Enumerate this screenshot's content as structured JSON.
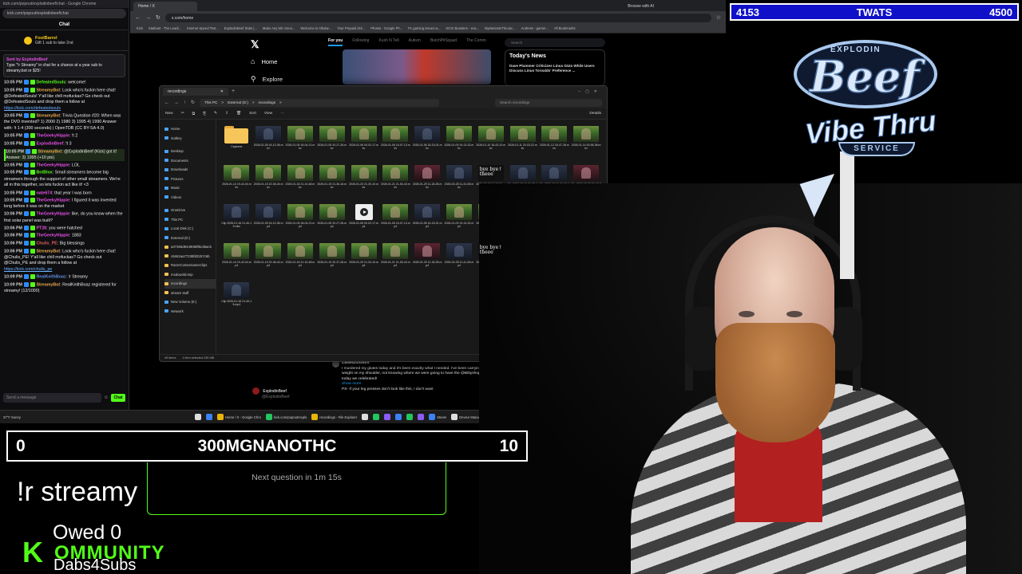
{
  "chat": {
    "window_title": "kick.com/popout/explodinbeef/chat - Google Chrome",
    "url": "kick.com/popout/explodinbeef/chat",
    "header": "Chat",
    "gift_user": "FoolBarrel",
    "gift_text": "Gift 1 sub to take 2nd",
    "pinned_by": "Sent by ExplodinBeef",
    "pinned_text": "Type \"!r Streamy\" in chat for a chance at a year sub to streamy.bot or $25!",
    "messages": [
      {
        "time": "10:05 PM",
        "user": "DefeatedSouls",
        "color": "#53fc18",
        "text": "welcome!"
      },
      {
        "time": "10:05 PM",
        "user": "StreamyBot",
        "color": "#e5a84f",
        "text": "Look who's fuckin here chat! @DefeatedSouls! Y'all like chill mofuckas? Go check out @DefeatedSouls and drop them a follow at",
        "link": "https://kick.com/defeatedsouls"
      },
      {
        "time": "10:05 PM",
        "user": "StreamyBot",
        "color": "#e5a84f",
        "text": "Trivia Question #20: When was the DVD invented? 1) 2000 2) 1980 3) 1995 4) 1990 Answer with: !t 1-4 (300 seconds) | OpenTDB (CC BY-SA 4.0)"
      },
      {
        "time": "10:05 PM",
        "user": "TheGeekyHippie",
        "color": "#e54fe5",
        "text": "!t 2"
      },
      {
        "time": "10:05 PM",
        "user": "ExplodinBeef",
        "color": "#e54fe5",
        "text": "!t 3"
      },
      {
        "time": "10:05 PM",
        "user": "StreamyBot",
        "color": "#e5a84f",
        "text": "@ExplodinBeef (Kick) got it! Answer: 3) 1995 (+10 pts)",
        "highlight": true
      },
      {
        "time": "10:05 PM",
        "user": "TheGeekyHippie",
        "color": "#e54fe5",
        "text": "LOL"
      },
      {
        "time": "10:05 PM",
        "user": "BotBlox",
        "color": "#53fc18",
        "text": "Small streamers become big streamers through the support of other small streamers. We're all in this together, so lets fuckin act like it! <3"
      },
      {
        "time": "10:05 PM",
        "user": "nate674",
        "color": "#e54fe5",
        "text": "that year I was born"
      },
      {
        "time": "10:05 PM",
        "user": "TheGeekyHippie",
        "color": "#e54fe5",
        "text": "I figured it was invented long before it was on the market"
      },
      {
        "time": "10:06 PM",
        "user": "TheGeekyHippie",
        "color": "#e54fe5",
        "text": "like, do you know when the first solar panel was built?"
      },
      {
        "time": "10:06 PM",
        "user": "PT28",
        "color": "#e54fe5",
        "text": "you were hatched"
      },
      {
        "time": "10:06 PM",
        "user": "TheGeekyHippie",
        "color": "#e54fe5",
        "text": "1883"
      },
      {
        "time": "10:06 PM",
        "user": "Chulis_PE",
        "color": "#e55f5f",
        "text": "Big blessings"
      },
      {
        "time": "10:06 PM",
        "user": "StreamyBot",
        "color": "#e5a84f",
        "text": "Look who's fuckin here chat! @Chulis_PE! Y'all like chill mofuckas? Go check out @Chulis_PE and drop them a follow at",
        "link": "https://kick.com/chulis_pe"
      },
      {
        "time": "10:09 PM",
        "user": "RealKeithBoaz",
        "color": "#5f8fe5",
        "text": "!r Streamy"
      },
      {
        "time": "10:09 PM",
        "user": "StreamyBot",
        "color": "#e5a84f",
        "text": "RealKeithBoaz registered for streamy! (12/1000)"
      }
    ],
    "input_placeholder": "Send a message",
    "send_label": "Chat"
  },
  "browser": {
    "tab_title": "Home / X",
    "url": "x.com/home",
    "right_label": "Browse with AI",
    "bookmarks": [
      "Kick",
      "Statbust - The Leadi...",
      "Internet Speed Test...",
      "ExplodinBeef Stats |...",
      "Make Any Mic Soun...",
      "Welcome to Okular...",
      "Your Prepaid (Kit...",
      "Photos - Google Ph...",
      "Pc gaming issues w...",
      "KICK Boosters - eva...",
      "MysteriesInTheJac...",
      "Andress - gamer...",
      "All Bookmarks"
    ],
    "x_nav": [
      {
        "icon": "⌂",
        "label": "Home"
      },
      {
        "icon": "⚲",
        "label": "Explore"
      }
    ],
    "x_tabs": [
      "For you",
      "Following",
      "Kush N Tell",
      "Autism",
      "ButchPitSquad",
      "The Comm"
    ],
    "search_placeholder": "Search",
    "news_title": "Today's News",
    "news_item": "Dave Plummer Criticizes Linux GUIs While Users Discuss Linus Torvalds' Preference ...",
    "post_user": "Lala420tokes",
    "post_text": "I murdered my glutes today and it's been exactly what I needed. I've been carrying around a huge weight on my shoulder, not knowing where we were going to have the @Bittyshop festival, but today we celebrated!",
    "post_text2": "PS- If your leg presses don't look like this, I don't want",
    "post_more": "Show more",
    "account_name": "ExplodinBeef",
    "account_handle": "@ExplodinBeef",
    "footer": "Terms of Service | Privacy Policy | Cookie Policy | Accessibility | Ads info | More | © 2026 X Corp."
  },
  "explorer": {
    "tab_title": "recordings",
    "path": [
      "This PC",
      ">",
      "External (D:)",
      ">",
      "recordings",
      ">"
    ],
    "search_placeholder": "Search recordings",
    "commands": [
      "New",
      "✂",
      "⧉",
      "⎘",
      "✎",
      "⇪",
      "🗑",
      "Sort",
      "View",
      "···"
    ],
    "details_label": "Details",
    "nav": [
      {
        "label": "Home",
        "type": "b"
      },
      {
        "label": "Gallery",
        "type": "b"
      },
      {
        "gap": true
      },
      {
        "label": "Desktop",
        "type": "b"
      },
      {
        "label": "Documents",
        "type": "b"
      },
      {
        "label": "Downloads",
        "type": "b"
      },
      {
        "label": "Pictures",
        "type": "b"
      },
      {
        "label": "Music",
        "type": "b"
      },
      {
        "label": "Videos",
        "type": "b"
      },
      {
        "gap": true
      },
      {
        "label": "OneDrive",
        "type": "b"
      },
      {
        "label": "This PC",
        "type": "b"
      },
      {
        "label": "Local Disk (C:)",
        "type": "b"
      },
      {
        "label": "External (D:)",
        "type": "b"
      },
      {
        "label": "a47366d9449088f5cd6ac5",
        "type": "f"
      },
      {
        "label": "c5652aa77238fd3257c5b",
        "type": "f"
      },
      {
        "label": "RazerCortexGameClips",
        "type": "f"
      },
      {
        "label": "msdownld.tmp",
        "type": "f"
      },
      {
        "label": "recordings",
        "type": "f",
        "selected": true
      },
      {
        "label": "stream stuff",
        "type": "f"
      },
      {
        "label": "New Volume (E:)",
        "type": "b"
      },
      {
        "label": "Network",
        "type": "b"
      }
    ],
    "files": [
      {
        "name": "Captures",
        "kind": "folder"
      },
      {
        "name": "2026-01-05 16-10-36.mkv",
        "kind": "dk"
      },
      {
        "name": "2026-01-05 18-04-21.mkv",
        "kind": "g"
      },
      {
        "name": "2026-01-05 20-27-26.mkv",
        "kind": "g"
      },
      {
        "name": "2026-01-06 00-02-17.mkv",
        "kind": "g"
      },
      {
        "name": "2026-01-06 16-07-13.mkv",
        "kind": "g"
      },
      {
        "name": "2026-01-06 18-15-01.mkv",
        "kind": "dk"
      },
      {
        "name": "2026-01-09 19-13-32.mkv",
        "kind": "g"
      },
      {
        "name": "2026-01-10 18-43-10.mkv",
        "kind": "g"
      },
      {
        "name": "2026-01-11 20-03-22.mkv",
        "kind": "g"
      },
      {
        "name": "2026-01-12 18-47-28.mkv",
        "kind": "g"
      },
      {
        "name": "2026-01-14 00-56-36.mkv",
        "kind": "g"
      },
      {
        "name": "2026-01-14 19-42-04.mkv",
        "kind": "g"
      },
      {
        "name": "2026-01-15 22-36-44.mkv",
        "kind": "g"
      },
      {
        "name": "2026-01-16 21-10-48.mkv",
        "kind": "g"
      },
      {
        "name": "2026-01-19 21-36-16.mkv",
        "kind": "g"
      },
      {
        "name": "2026-01-20 21-20-10.mkv",
        "kind": "g"
      },
      {
        "name": "2026-01-21 21-53-43.mkv",
        "kind": "g"
      },
      {
        "name": "2026-01-29 11-18-25.mkv",
        "kind": "rd"
      },
      {
        "name": "2026-02-28 11-41-08.mkv",
        "kind": "dk"
      },
      {
        "name": "2026-03-13 04-12-21.mkv",
        "kind": "bw",
        "overlay": "bye bye↑ theee"
      },
      {
        "name": "Clip 2026-02-21 21-52-40.mkv",
        "kind": "dk"
      },
      {
        "name": "Clip 2026-02-21 21-52-40.mkv",
        "kind": "dk"
      },
      {
        "name": "Clip 2026-02-22 20-18-38.mkv",
        "kind": "rd"
      },
      {
        "name": "Clip 2026-01-16 21-40-15.mkv",
        "kind": "dk"
      },
      {
        "name": "2026-01-05 16-10-36.mp4",
        "kind": "dk"
      },
      {
        "name": "2026-01-05 18-04-21.mp4",
        "kind": "g"
      },
      {
        "name": "2026-01-05 20-27-26.mp4",
        "kind": "g"
      },
      {
        "name": "2026-01-06 00-02-17.mp4",
        "kind": "play"
      },
      {
        "name": "2026-01-06 16-07-13.mp4",
        "kind": "g"
      },
      {
        "name": "2026-01-06 16-16-01.mp4",
        "kind": "dk"
      },
      {
        "name": "2026-01-09 19-13-32.mp4",
        "kind": "g"
      },
      {
        "name": "2026-01-10 18-43-10.mp4",
        "kind": "g"
      },
      {
        "name": "2026-01-11 20-49-31.mp4",
        "kind": "g"
      },
      {
        "name": "2026-01-12 18-47-28.mp4",
        "kind": "g"
      },
      {
        "name": "2026-01-14 00-56-36.mp4",
        "kind": "g"
      },
      {
        "name": "2026-01-14 19-42-04.mp4",
        "kind": "g"
      },
      {
        "name": "2026-01-15 22-36-44.mp4",
        "kind": "g"
      },
      {
        "name": "2026-01-16 21-10-48.mp4",
        "kind": "g"
      },
      {
        "name": "2026-01-19 20-37-26.mp4",
        "kind": "g"
      },
      {
        "name": "2026-01-20 21-20-10.mp4",
        "kind": "g"
      },
      {
        "name": "2026-01-21 21-53-43.mp4",
        "kind": "g"
      },
      {
        "name": "2026-01-29 11-18-25.mp4",
        "kind": "rd"
      },
      {
        "name": "2026-02-28 11-41-08.mp4",
        "kind": "dk"
      },
      {
        "name": "2026-03-13 04-12-21.mp4",
        "kind": "bw",
        "overlay": "bye bye↑ theee"
      },
      {
        "name": "Clip 2026-02-21 21-52-40.mp4",
        "kind": "dk"
      },
      {
        "name": "Clip 2026-02-21 21-52-40.mp4",
        "kind": "dk"
      },
      {
        "name": "Clip 2026-02-22 20-18-38.mp4",
        "kind": "rd"
      },
      {
        "name": "Clip 2026-01-16 21-40-15.mp4",
        "kind": "dk"
      }
    ],
    "status_count": "49 items",
    "status_selected": "1 item selected 235 MB"
  },
  "taskbar": {
    "weather": "37°F Sunny",
    "apps": [
      {
        "label": "Home / X - Google Chro",
        "color": "y"
      },
      {
        "label": "kick.com/popout/explo",
        "color": "g"
      },
      {
        "label": "recordings - File Explorer",
        "color": "y"
      },
      {
        "label": "",
        "color": "w"
      },
      {
        "label": "",
        "color": "g"
      },
      {
        "label": "",
        "color": "p"
      },
      {
        "label": "",
        "color": "b"
      },
      {
        "label": "",
        "color": "g"
      },
      {
        "label": "",
        "color": "p"
      },
      {
        "label": "Steam",
        "color": "b"
      },
      {
        "label": "Device Manager",
        "color": "w"
      },
      {
        "label": "ICUE",
        "color": "r"
      }
    ]
  },
  "overlays": {
    "top_score_left": "4153",
    "top_score_title": "TWATS",
    "top_score_right": "4500",
    "logo_top": "EXPLODIN",
    "logo_main": "Beef",
    "logo_vibe": "Vibe Thru",
    "logo_service": "SERVICE",
    "mid_score_left": "0",
    "mid_score_title": "300MGNANOTHC",
    "mid_score_right": "10",
    "command": "!r streamy",
    "question": "Next question in 1m 15s",
    "owed": "Owed 0",
    "kommunity_k": "K",
    "kommunity_word": "OMMUNITY",
    "dabs": "Dabs4Subs"
  }
}
